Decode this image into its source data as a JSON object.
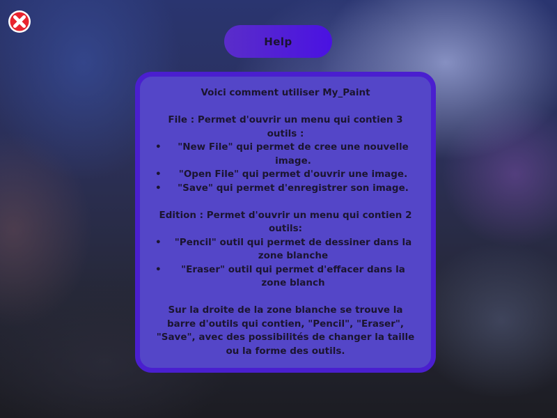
{
  "close_button": {
    "icon": "close-icon",
    "color": "#e8242e"
  },
  "help_button": {
    "label": "Help"
  },
  "help_panel": {
    "title": "Voici comment utiliser My_Paint",
    "file_section": {
      "heading": "File : Permet d'ouvrir un menu qui contien 3 outils :",
      "items": [
        "\"New File\" qui permet de cree une nouvelle image.",
        "\"Open File\" qui permet d'ouvrir une image.",
        "\"Save\" qui permet d'enregistrer son image."
      ]
    },
    "edition_section": {
      "heading": "Edition : Permet  d'ouvrir un menu qui contien 2 outils:",
      "items": [
        "\"Pencil\" outil qui permet de dessiner dans la zone blanche",
        "\"Eraser\" outil qui permet d'effacer dans la zone blanch"
      ]
    },
    "footer": "Sur la droite de la zone blanche se trouve la barre d'outils qui contien, \"Pencil\", \"Eraser\", \"Save\", avec des possibilités de changer la taille ou la forme des outils.",
    "bullet": "•"
  }
}
